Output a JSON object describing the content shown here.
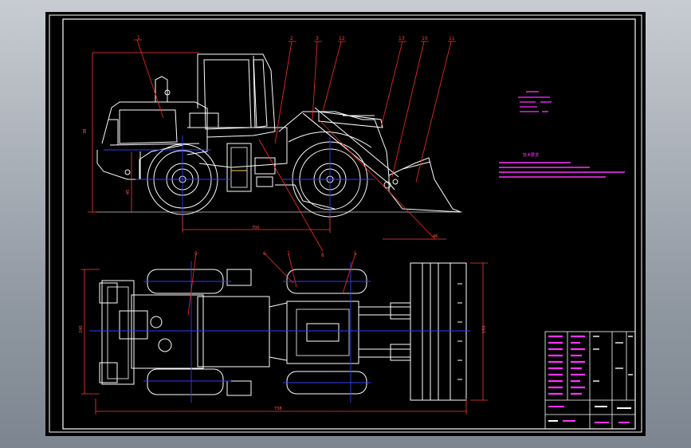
{
  "colors": {
    "background": "#000000",
    "outline": "#ffffff",
    "leader": "#ff2a2a",
    "centerline": "#2f3cff",
    "note": "#ff33ff",
    "dimension": "#ff5a5a",
    "frame": "#ffffff"
  },
  "balloons": {
    "side": [
      "1",
      "2",
      "3",
      "12",
      "13",
      "10",
      "11",
      "8"
    ],
    "top": [
      "9",
      "6",
      "7",
      "5"
    ]
  },
  "dimensions": {
    "side_height": "38",
    "side_ground": "45",
    "side_wheelbase": "700",
    "side_reach": "46",
    "top_width": "240",
    "top_length": "738",
    "top_bucket_width": "150"
  },
  "notes": {
    "tech_title": "技术要求",
    "tech_lines": [
      "",
      "",
      "",
      ""
    ],
    "spec_lines": [
      "",
      "",
      "",
      "",
      "",
      "",
      ""
    ]
  },
  "title_block": {
    "drawing_title": "",
    "drawing_number": ""
  }
}
